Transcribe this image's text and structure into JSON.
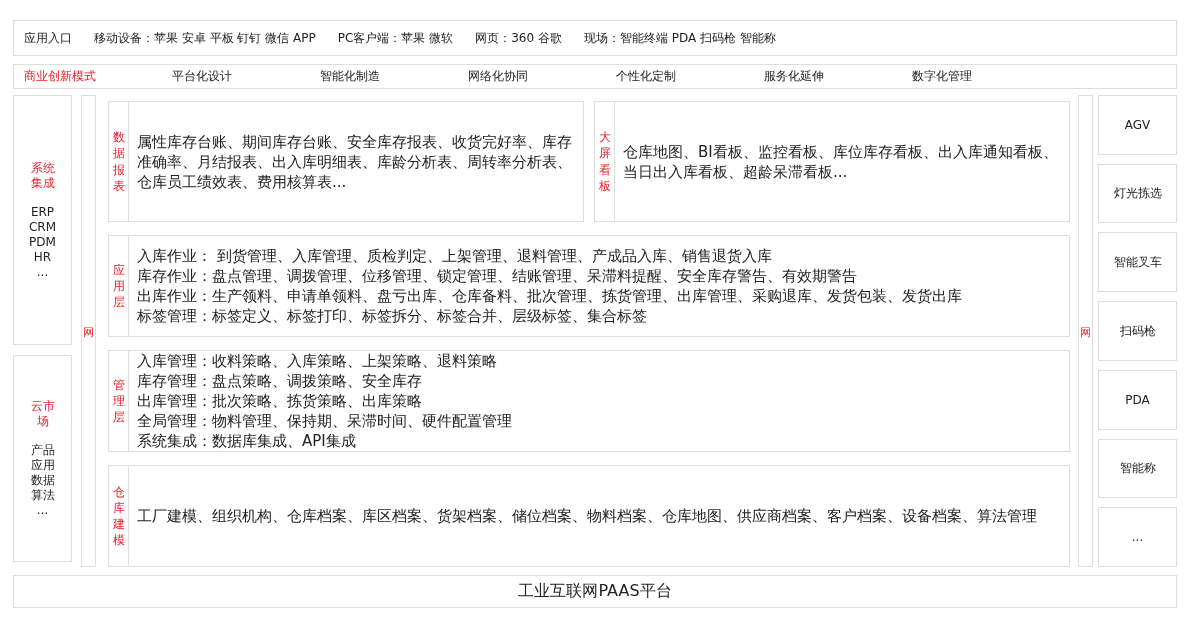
{
  "entry_bar": {
    "title": "应用入口",
    "groups": [
      "移动设备：苹果 安卓  平板 钉钉 微信 APP",
      "PC客户端：苹果 微软",
      "网页：360 谷歌",
      "现场：智能终端 PDA 扫码枪 智能称"
    ]
  },
  "nav": [
    {
      "label": "商业创新模式",
      "selected": true
    },
    {
      "label": "平台化设计",
      "selected": false
    },
    {
      "label": "智能化制造",
      "selected": false
    },
    {
      "label": "网络化协同",
      "selected": false
    },
    {
      "label": "个性化定制",
      "selected": false
    },
    {
      "label": "服务化延伸",
      "selected": false
    },
    {
      "label": "数字化管理",
      "selected": false
    }
  ],
  "left_panels": [
    {
      "title": "系统集成",
      "items": [
        "ERP",
        "CRM",
        "PDM",
        "HR",
        "..."
      ]
    },
    {
      "title": "云市场",
      "items": [
        "产品",
        "应用",
        "数据",
        "算法",
        "..."
      ]
    }
  ],
  "network_left": "网",
  "top_modules": [
    {
      "label": "数据报表",
      "text": "属性库存台账、期间库存台账、安全库存报表、收货完好率、库存准确率、月结报表、出入库明细表、库龄分析表、周转率分析表、仓库员工绩效表、费用核算表..."
    },
    {
      "label": "大屏看板",
      "text": "仓库地图、BI看板、监控看板、库位库存看板、出入库通知看板、当日出入库看板、超龄呆滞看板..."
    }
  ],
  "layers": [
    {
      "label": "应用层",
      "lines": [
        "入库作业： 到货管理、入库管理、质检判定、上架管理、退料管理、产成品入库、销售退货入库",
        "库存作业：盘点管理、调拨管理、位移管理、锁定管理、结账管理、呆滞料提醒、安全库存警告、有效期警告",
        "出库作业：生产领料、申请单领料、盘亏出库、仓库备料、批次管理、拣货管理、出库管理、采购退库、发货包装、发货出库",
        "标签管理：标签定义、标签打印、标签拆分、标签合并、层级标签、集合标签"
      ]
    },
    {
      "label": "管理层",
      "lines": [
        "入库管理：收料策略、入库策略、上架策略、退料策略",
        "库存管理：盘点策略、调拨策略、安全库存",
        "出库管理：批次策略、拣货策略、出库策略",
        "全局管理：物料管理、保持期、呆滞时间、硬件配置管理",
        "系统集成：数据库集成、API集成"
      ]
    },
    {
      "label": "仓库建模",
      "lines": [
        "工厂建模、组织机构、仓库档案、库区档案、货架档案、储位档案、物料档案、仓库地图、供应商档案、客户档案、设备档案、算法管理"
      ]
    }
  ],
  "network_right": "网",
  "devices": [
    "AGV",
    "灯光拣选",
    "智能叉车",
    "扫码枪",
    "PDA",
    "智能称",
    "..."
  ],
  "platform": "工业互联网PAAS平台"
}
